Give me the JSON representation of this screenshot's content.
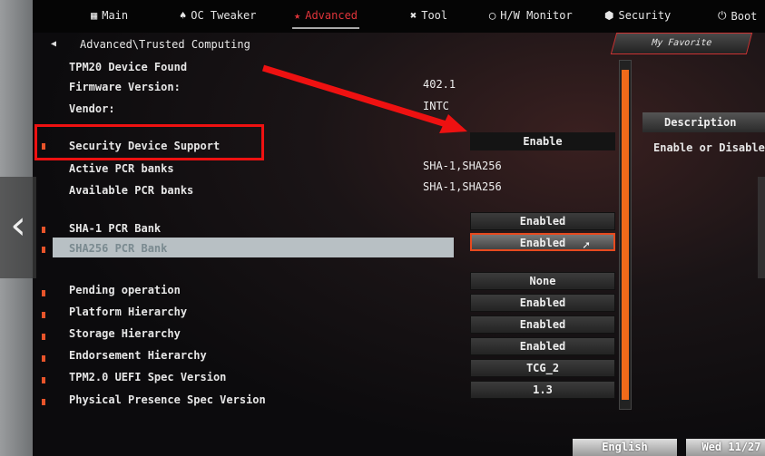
{
  "nav": {
    "tabs": [
      {
        "label": "Main",
        "icon": "grid-icon"
      },
      {
        "label": "OC Tweaker",
        "icon": "flame-icon"
      },
      {
        "label": "Advanced",
        "icon": "star-icon",
        "active": true
      },
      {
        "label": "Tool",
        "icon": "tools-icon"
      },
      {
        "label": "H/W Monitor",
        "icon": "monitor-icon"
      },
      {
        "label": "Security",
        "icon": "shield-icon"
      },
      {
        "label": "Boot",
        "icon": "power-icon"
      }
    ]
  },
  "breadcrumb": "Advanced\\Trusted Computing",
  "favorite_label": "My Favorite",
  "info": [
    {
      "label": "TPM20 Device Found",
      "value": ""
    },
    {
      "label": "Firmware Version:",
      "value": "402.1"
    },
    {
      "label": "Vendor:",
      "value": "INTC"
    }
  ],
  "security_device_support": {
    "label": "Security Device Support",
    "value": "Enable"
  },
  "pcr": [
    {
      "label": "Active PCR banks",
      "value": "SHA-1,SHA256"
    },
    {
      "label": "Available PCR banks",
      "value": "SHA-1,SHA256"
    }
  ],
  "banks": [
    {
      "label": "SHA-1 PCR Bank",
      "value": "Enabled"
    },
    {
      "label": "SHA256 PCR Bank",
      "value": "Enabled",
      "selected": true
    }
  ],
  "settings": [
    {
      "label": "Pending operation",
      "value": "None"
    },
    {
      "label": "Platform Hierarchy",
      "value": "Enabled"
    },
    {
      "label": "Storage Hierarchy",
      "value": "Enabled"
    },
    {
      "label": "Endorsement Hierarchy",
      "value": "Enabled"
    },
    {
      "label": "TPM2.0 UEFI Spec Version",
      "value": "TCG_2"
    },
    {
      "label": "Physical Presence Spec Version",
      "value": "1.3"
    }
  ],
  "description": {
    "title": "Description",
    "text": "Enable or Disable"
  },
  "footer": {
    "language": "English",
    "date": "Wed 11/27"
  },
  "colors": {
    "accent": "#e0343a",
    "scroll": "#f06a1a",
    "annotation": "#ee1111"
  }
}
